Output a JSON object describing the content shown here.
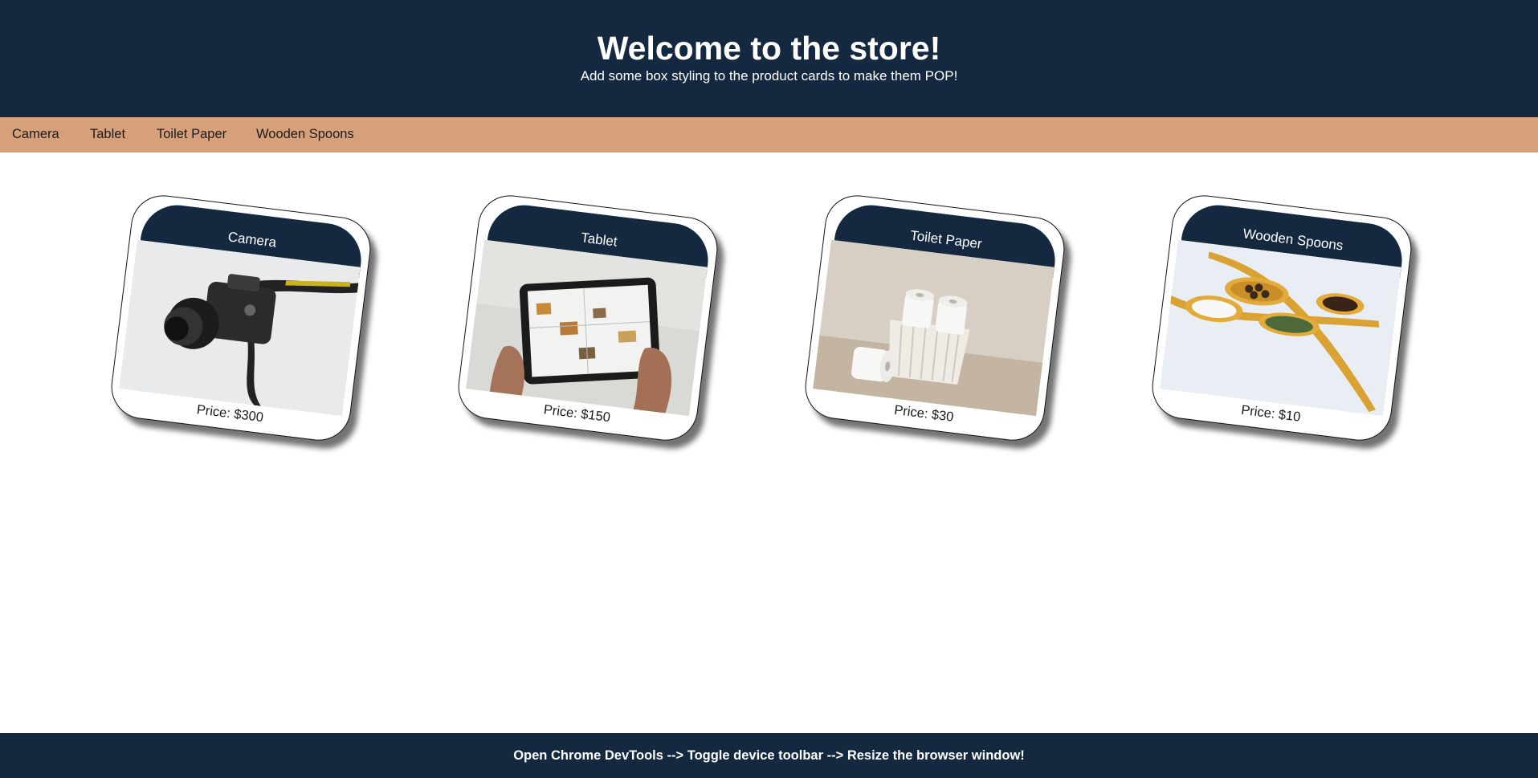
{
  "header": {
    "title": "Welcome to the store!",
    "subtitle": "Add some box styling to the product cards to make them POP!"
  },
  "nav": {
    "items": [
      {
        "label": "Camera"
      },
      {
        "label": "Tablet"
      },
      {
        "label": "Toilet Paper"
      },
      {
        "label": "Wooden Spoons"
      }
    ]
  },
  "products": [
    {
      "name": "Camera",
      "price": "Price: $300",
      "image": "camera-photo"
    },
    {
      "name": "Tablet",
      "price": "Price: $150",
      "image": "tablet-photo"
    },
    {
      "name": "Toilet Paper",
      "price": "Price: $30",
      "image": "toilet-paper-photo"
    },
    {
      "name": "Wooden Spoons",
      "price": "Price: $10",
      "image": "wooden-spoons-photo"
    }
  ],
  "footer": {
    "text": "Open Chrome DevTools --> Toggle device toolbar --> Resize the browser window!"
  },
  "colors": {
    "header_bg": "#142940",
    "nav_bg": "#d6a07b",
    "card_border": "#111111"
  }
}
